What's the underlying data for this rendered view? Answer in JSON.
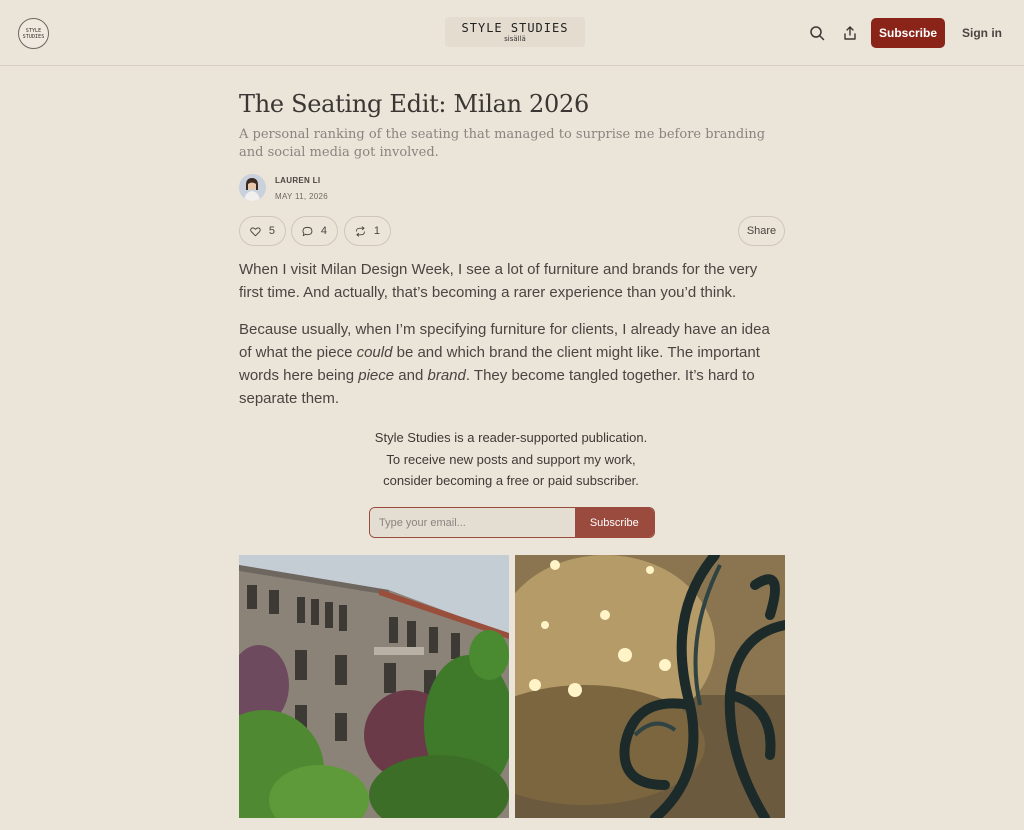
{
  "header": {
    "logo_line1": "STYLE",
    "logo_line2": "STUDIES",
    "masthead_title": "STYLE STUDIES",
    "masthead_sub": "sisällä",
    "subscribe_label": "Subscribe",
    "signin_label": "Sign in",
    "icons": [
      "search-icon",
      "share-upload-icon"
    ]
  },
  "article": {
    "title": "The Seating Edit: Milan 2026",
    "subtitle": "A personal ranking of the seating that managed to surprise me before branding and social media got involved.",
    "author": "LAUREN LI",
    "date": "MAY 11, 2026",
    "likes": "5",
    "comments": "4",
    "restacks": "1",
    "share_label": "Share",
    "para1": "When I visit Milan Design Week, I see a lot of furniture and brands for the very first time. And actually, that’s becoming a rarer experience than you’d think.",
    "para2_a": "Because usually, when I’m specifying furniture for clients, I already have an idea of what the piece ",
    "para2_em1": "could",
    "para2_b": " be and which brand the client might like. The important words here being ",
    "para2_em2": "piece",
    "para2_c": " and ",
    "para2_em3": "brand",
    "para2_d": ". They become tangled together. It’s hard to separate them."
  },
  "cta": {
    "line1": "Style Studies is a reader-supported publication.",
    "line2": "To receive new posts and support my work,",
    "line3": "consider becoming a free or paid subscriber.",
    "email_placeholder": "Type your email...",
    "submit_label": "Subscribe"
  },
  "colors": {
    "background": "#ebe4d8",
    "brand": "#8a2318",
    "form_accent": "#9b4a3e"
  }
}
